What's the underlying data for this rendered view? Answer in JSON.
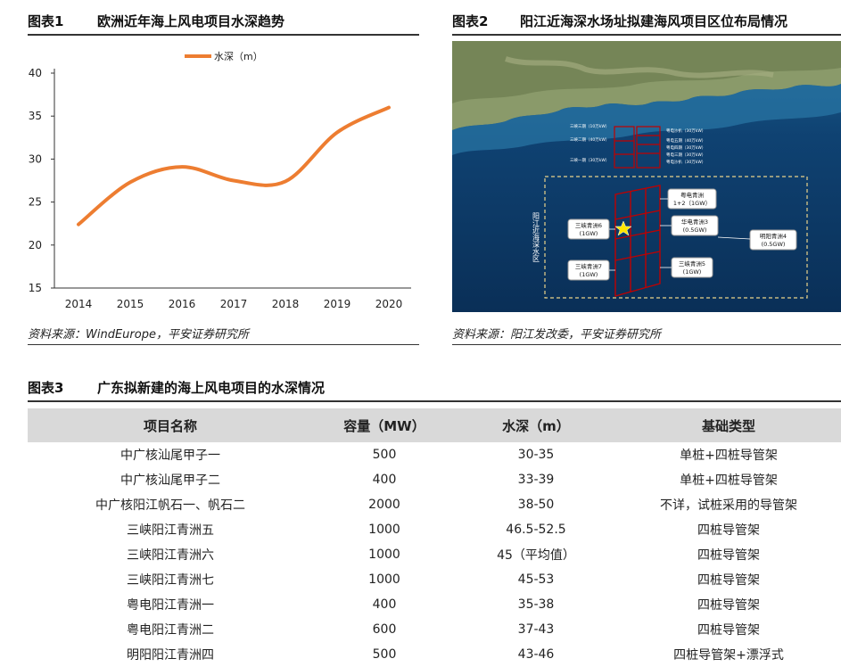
{
  "fig1": {
    "label": "图表1",
    "title": "欧洲近年海上风电项目水深趋势",
    "source": "资料来源：WindEurope，平安证券研究所"
  },
  "fig2": {
    "label": "图表2",
    "title": "阳江近海深水场址拟建海风项目区位布局情况",
    "source": "资料来源：阳江发改委，平安证券研究所",
    "zone_label": "阳江近海深水区",
    "boxes": [
      {
        "name": "粤电青洲",
        "line2": "1+2（1GW）"
      },
      {
        "name": "华电青洲3",
        "line2": "(0.5GW)"
      },
      {
        "name": "三峡青洲6",
        "line2": "(1GW)"
      },
      {
        "name": "明阳青洲4",
        "line2": "(0.5GW)"
      },
      {
        "name": "三峡青洲7",
        "line2": "(1GW)"
      },
      {
        "name": "三峡青洲5",
        "line2": "(1GW)"
      }
    ],
    "legend_left": [
      "三峡三期（10万kW）",
      "三峡二期（40万kW）",
      "三峡一期（30万kW）"
    ],
    "legend_right": [
      "粤电沙扒（30万kW）",
      "粤电五期（40万kW）",
      "粤电四期（30万kW）",
      "粤电三期（30万kW）",
      "粤电沙扒（30万kW）"
    ],
    "colors": {
      "sea": "#0d3a66",
      "grid": "#c00000",
      "zone": "#e8d28a"
    }
  },
  "chart_data": {
    "type": "line",
    "title": "",
    "legend": "水深（m）",
    "x": [
      "2014",
      "2015",
      "2016",
      "2017",
      "2018",
      "2019",
      "2020"
    ],
    "series": [
      {
        "name": "水深（m）",
        "values": [
          22.4,
          27.3,
          29.1,
          27.5,
          27.4,
          33.1,
          36.0
        ]
      }
    ],
    "ylim": [
      15,
      40
    ],
    "yticks": [
      "15",
      "20",
      "25",
      "30",
      "35",
      "40"
    ],
    "grid": false,
    "color": "#ed7d31"
  },
  "fig3": {
    "label": "图表3",
    "title": "广东拟新建的海上风电项目的水深情况",
    "headers": [
      "项目名称",
      "容量（MW）",
      "水深（m）",
      "基础类型"
    ],
    "rows": [
      [
        "中广核汕尾甲子一",
        "500",
        "30-35",
        "单桩+四桩导管架"
      ],
      [
        "中广核汕尾甲子二",
        "400",
        "33-39",
        "单桩+四桩导管架"
      ],
      [
        "中广核阳江帆石一、帆石二",
        "2000",
        "38-50",
        "不详，试桩采用的导管架"
      ],
      [
        "三峡阳江青洲五",
        "1000",
        "46.5-52.5",
        "四桩导管架"
      ],
      [
        "三峡阳江青洲六",
        "1000",
        "45（平均值）",
        "四桩导管架"
      ],
      [
        "三峡阳江青洲七",
        "1000",
        "45-53",
        "四桩导管架"
      ],
      [
        "粤电阳江青洲一",
        "400",
        "35-38",
        "四桩导管架"
      ],
      [
        "粤电阳江青洲二",
        "600",
        "37-43",
        "四桩导管架"
      ],
      [
        "明阳阳江青洲四",
        "500",
        "43-46",
        "四桩导管架+漂浮式"
      ]
    ]
  }
}
